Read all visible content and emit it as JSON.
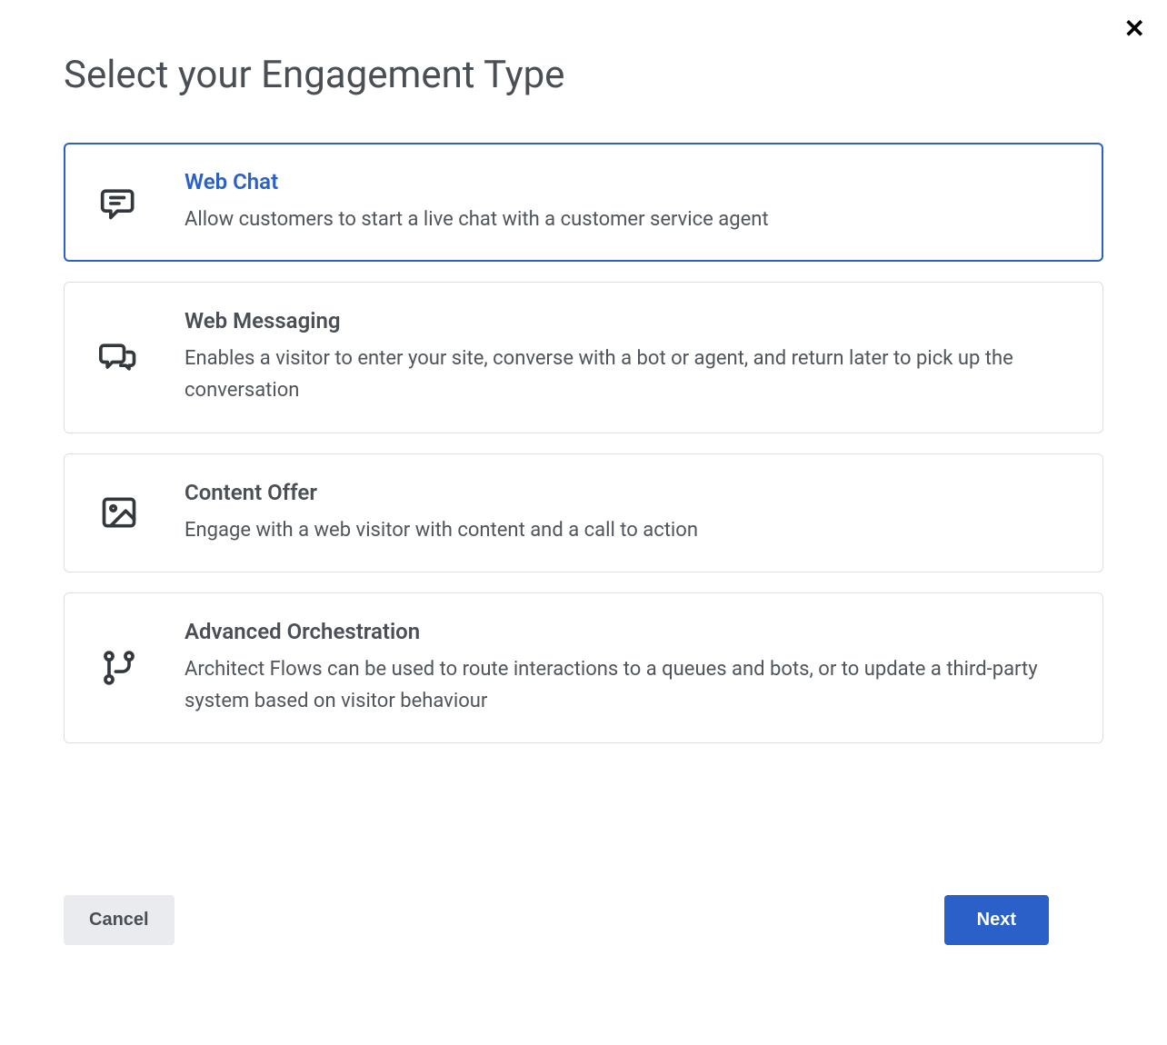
{
  "dialog": {
    "title": "Select your Engagement Type",
    "options": [
      {
        "title": "Web Chat",
        "description": "Allow customers to start a live chat with a customer service agent",
        "selected": true
      },
      {
        "title": "Web Messaging",
        "description": "Enables a visitor to enter your site, converse with a bot or agent, and return later to pick up the conversation",
        "selected": false
      },
      {
        "title": "Content Offer",
        "description": "Engage with a web visitor with content and a call to action",
        "selected": false
      },
      {
        "title": "Advanced Orchestration",
        "description": "Architect Flows can be used to route interactions to a queues and bots, or to update a third-party system based on visitor behaviour",
        "selected": false
      }
    ],
    "buttons": {
      "cancel": "Cancel",
      "next": "Next"
    }
  }
}
